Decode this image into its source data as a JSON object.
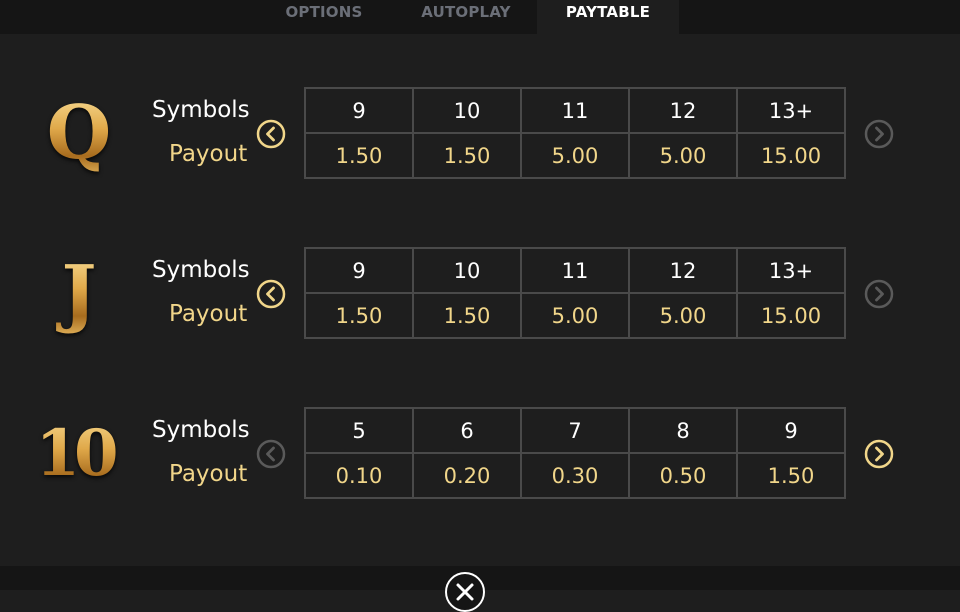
{
  "tabs": [
    {
      "label": "OPTIONS",
      "active": false
    },
    {
      "label": "AUTOPLAY",
      "active": false
    },
    {
      "label": "PAYTABLE",
      "active": true
    }
  ],
  "labels": {
    "symbols": "Symbols",
    "payout": "Payout"
  },
  "colors": {
    "accent": "#f1d68a",
    "arrow_enabled": "#f1d68a",
    "arrow_disabled": "#5a5a5a",
    "cell_border": "#4a4a4a",
    "background": "#1e1e1e"
  },
  "rows": [
    {
      "symbol": "Q",
      "counts": [
        "9",
        "10",
        "11",
        "12",
        "13+"
      ],
      "payouts": [
        "1.50",
        "1.50",
        "5.00",
        "5.00",
        "15.00"
      ],
      "left_arrow": "chevron-left-icon",
      "left_enabled": true,
      "right_arrow": "chevron-right-icon",
      "right_enabled": false
    },
    {
      "symbol": "J",
      "counts": [
        "9",
        "10",
        "11",
        "12",
        "13+"
      ],
      "payouts": [
        "1.50",
        "1.50",
        "5.00",
        "5.00",
        "15.00"
      ],
      "left_arrow": "chevron-left-icon",
      "left_enabled": true,
      "right_arrow": "chevron-right-icon",
      "right_enabled": false
    },
    {
      "symbol": "10",
      "counts": [
        "5",
        "6",
        "7",
        "8",
        "9"
      ],
      "payouts": [
        "0.10",
        "0.20",
        "0.30",
        "0.50",
        "1.50"
      ],
      "left_arrow": "chevron-left-icon",
      "left_enabled": false,
      "right_arrow": "chevron-right-icon",
      "right_enabled": true
    }
  ],
  "close_icon": "close-icon"
}
